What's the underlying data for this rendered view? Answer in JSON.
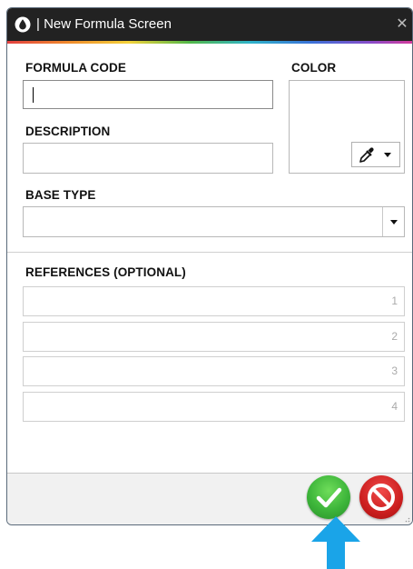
{
  "window": {
    "title": "| New Formula Screen",
    "close_glyph": "✕",
    "icon": "drop-icon"
  },
  "form": {
    "formula_code": {
      "label": "FORMULA CODE",
      "value": ""
    },
    "description": {
      "label": "DESCRIPTION",
      "value": ""
    },
    "color": {
      "label": "COLOR",
      "picker_icon": "eyedropper-icon",
      "selected_value": ""
    },
    "base_type": {
      "label": "BASE TYPE",
      "selected_value": ""
    },
    "references": {
      "label": "REFERENCES (OPTIONAL)",
      "rows": [
        {
          "number": "1",
          "value": ""
        },
        {
          "number": "2",
          "value": ""
        },
        {
          "number": "3",
          "value": ""
        },
        {
          "number": "4",
          "value": ""
        }
      ]
    }
  },
  "footer": {
    "ok_icon": "checkmark-icon",
    "cancel_icon": "no-entry-icon"
  },
  "colors": {
    "titlebar_bg": "#222222",
    "ok_green": "#3db53a",
    "cancel_red": "#cc1f1f",
    "pointer_blue": "#1aa4e8"
  }
}
